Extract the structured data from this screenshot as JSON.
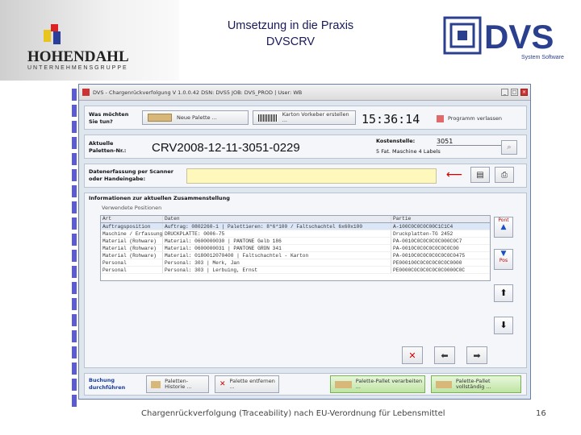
{
  "slide": {
    "title_line1": "Umsetzung in die Praxis",
    "title_line2": "DVSCRV",
    "footer": "Chargenrückverfolgung (Traceability) nach EU-Verordnung für Lebensmittel",
    "page_number": "16"
  },
  "logo_left": {
    "name": "HOHENDAHL",
    "sub": "UNTERNEHMENSGRUPPE"
  },
  "logo_right": {
    "text": "DVS",
    "sub": "System Software"
  },
  "window": {
    "title": "DVS - Chargenrückverfolgung V 1.0.0.42   DSN: DVS5 JOB: DVS_PROD | User: WB",
    "question_label": "Was möchten Sie tun?",
    "btn_new_pallet": "Neue Palette ...",
    "btn_create_carton": "Karton Vorkeber erstellen ...",
    "clock": "15:36:14",
    "btn_exit": "Programm verlassen",
    "current_pallet_label": "Aktuelle Paletten-Nr.:",
    "current_pallet_value": "CRV2008-12-11-3051-0229",
    "cost_center_label": "Kostenstelle:",
    "cost_center_value": "3051",
    "cost_center_desc": "5 Fat. Maschine 4 Labels",
    "scanner_label": "Datenerfassung per Scanner oder Handeingabe:",
    "info_label": "Informationen zur aktuellen Zusammenstellung",
    "positions_label": "Verwendete Positionen",
    "grid_headers": [
      "Art",
      "Daten",
      "Partie"
    ],
    "grid_rows": [
      [
        "Auftragsposition",
        "Auftrag: 0802260-1 | Palettieren: 8*6*100 / Faltschachtel 6x60x100",
        "A-100C0C0C0C00C1C1C4"
      ],
      [
        "Maschine / Erfassung",
        "DRUCKPLATTE: 0006-75",
        "Druckplatten-TG 2452"
      ],
      [
        "Material (Rohware)",
        "Material: 0600000030 | PANTONE Gelb 186",
        "PA-0010C0C0C0C0C000C0C7"
      ],
      [
        "Material (Rohware)",
        "Material: 0600000031 | PANTONE GRÜN 341",
        "PA-0010C0C0C0C0C0C0C00"
      ],
      [
        "Material (Rohware)",
        "Material: 0180012070400 | Faltschachtel - Karton",
        "PA-0010C0C0C0C0C0C0C0475"
      ],
      [
        "Personal",
        "Personal: 303 | Merk, Jan",
        "PE000100C0C0C0C0C0C0000"
      ],
      [
        "Personal",
        "Personal: 303 | Lerbuing, Ernst",
        "PE0000C0C0C0C0C0C0000C0C"
      ]
    ],
    "side_top": "Pont",
    "side_bottom": "Pos",
    "booking_label": "Buchung durchführen",
    "btn_history": "Paletten-Historie ...",
    "btn_remove": "Palette entfernen ...",
    "btn_finish": "Palette-Pallet verarbeiten ...",
    "btn_complete": "Palette-Pallet vollständig ..."
  }
}
